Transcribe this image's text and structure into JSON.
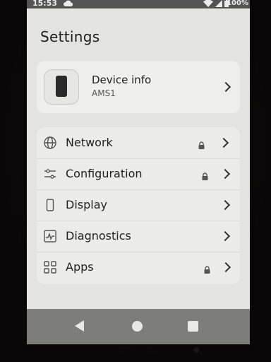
{
  "status": {
    "time": "15:53",
    "battery": "100%",
    "icons": [
      "cloud-icon",
      "wifi-icon",
      "signal-icon",
      "battery-icon"
    ]
  },
  "title": "Settings",
  "device": {
    "name": "Device info",
    "id": "AMS1",
    "icon": "phone-icon"
  },
  "menu": [
    {
      "label": "Network",
      "icon": "globe-icon",
      "locked": true
    },
    {
      "label": "Configuration",
      "icon": "sliders-icon",
      "locked": true
    },
    {
      "label": "Display",
      "icon": "display-icon",
      "locked": false
    },
    {
      "label": "Diagnostics",
      "icon": "pulse-icon",
      "locked": false
    },
    {
      "label": "Apps",
      "icon": "apps-grid-icon",
      "locked": true
    }
  ],
  "nav": [
    "back-icon",
    "home-icon",
    "recent-apps-icon"
  ],
  "colors": {
    "screen_bg": "#e4e4e2",
    "card_bg": "#efefed",
    "statusbar": "#535453",
    "navbar": "#7d7d7b",
    "text": "#222222"
  }
}
